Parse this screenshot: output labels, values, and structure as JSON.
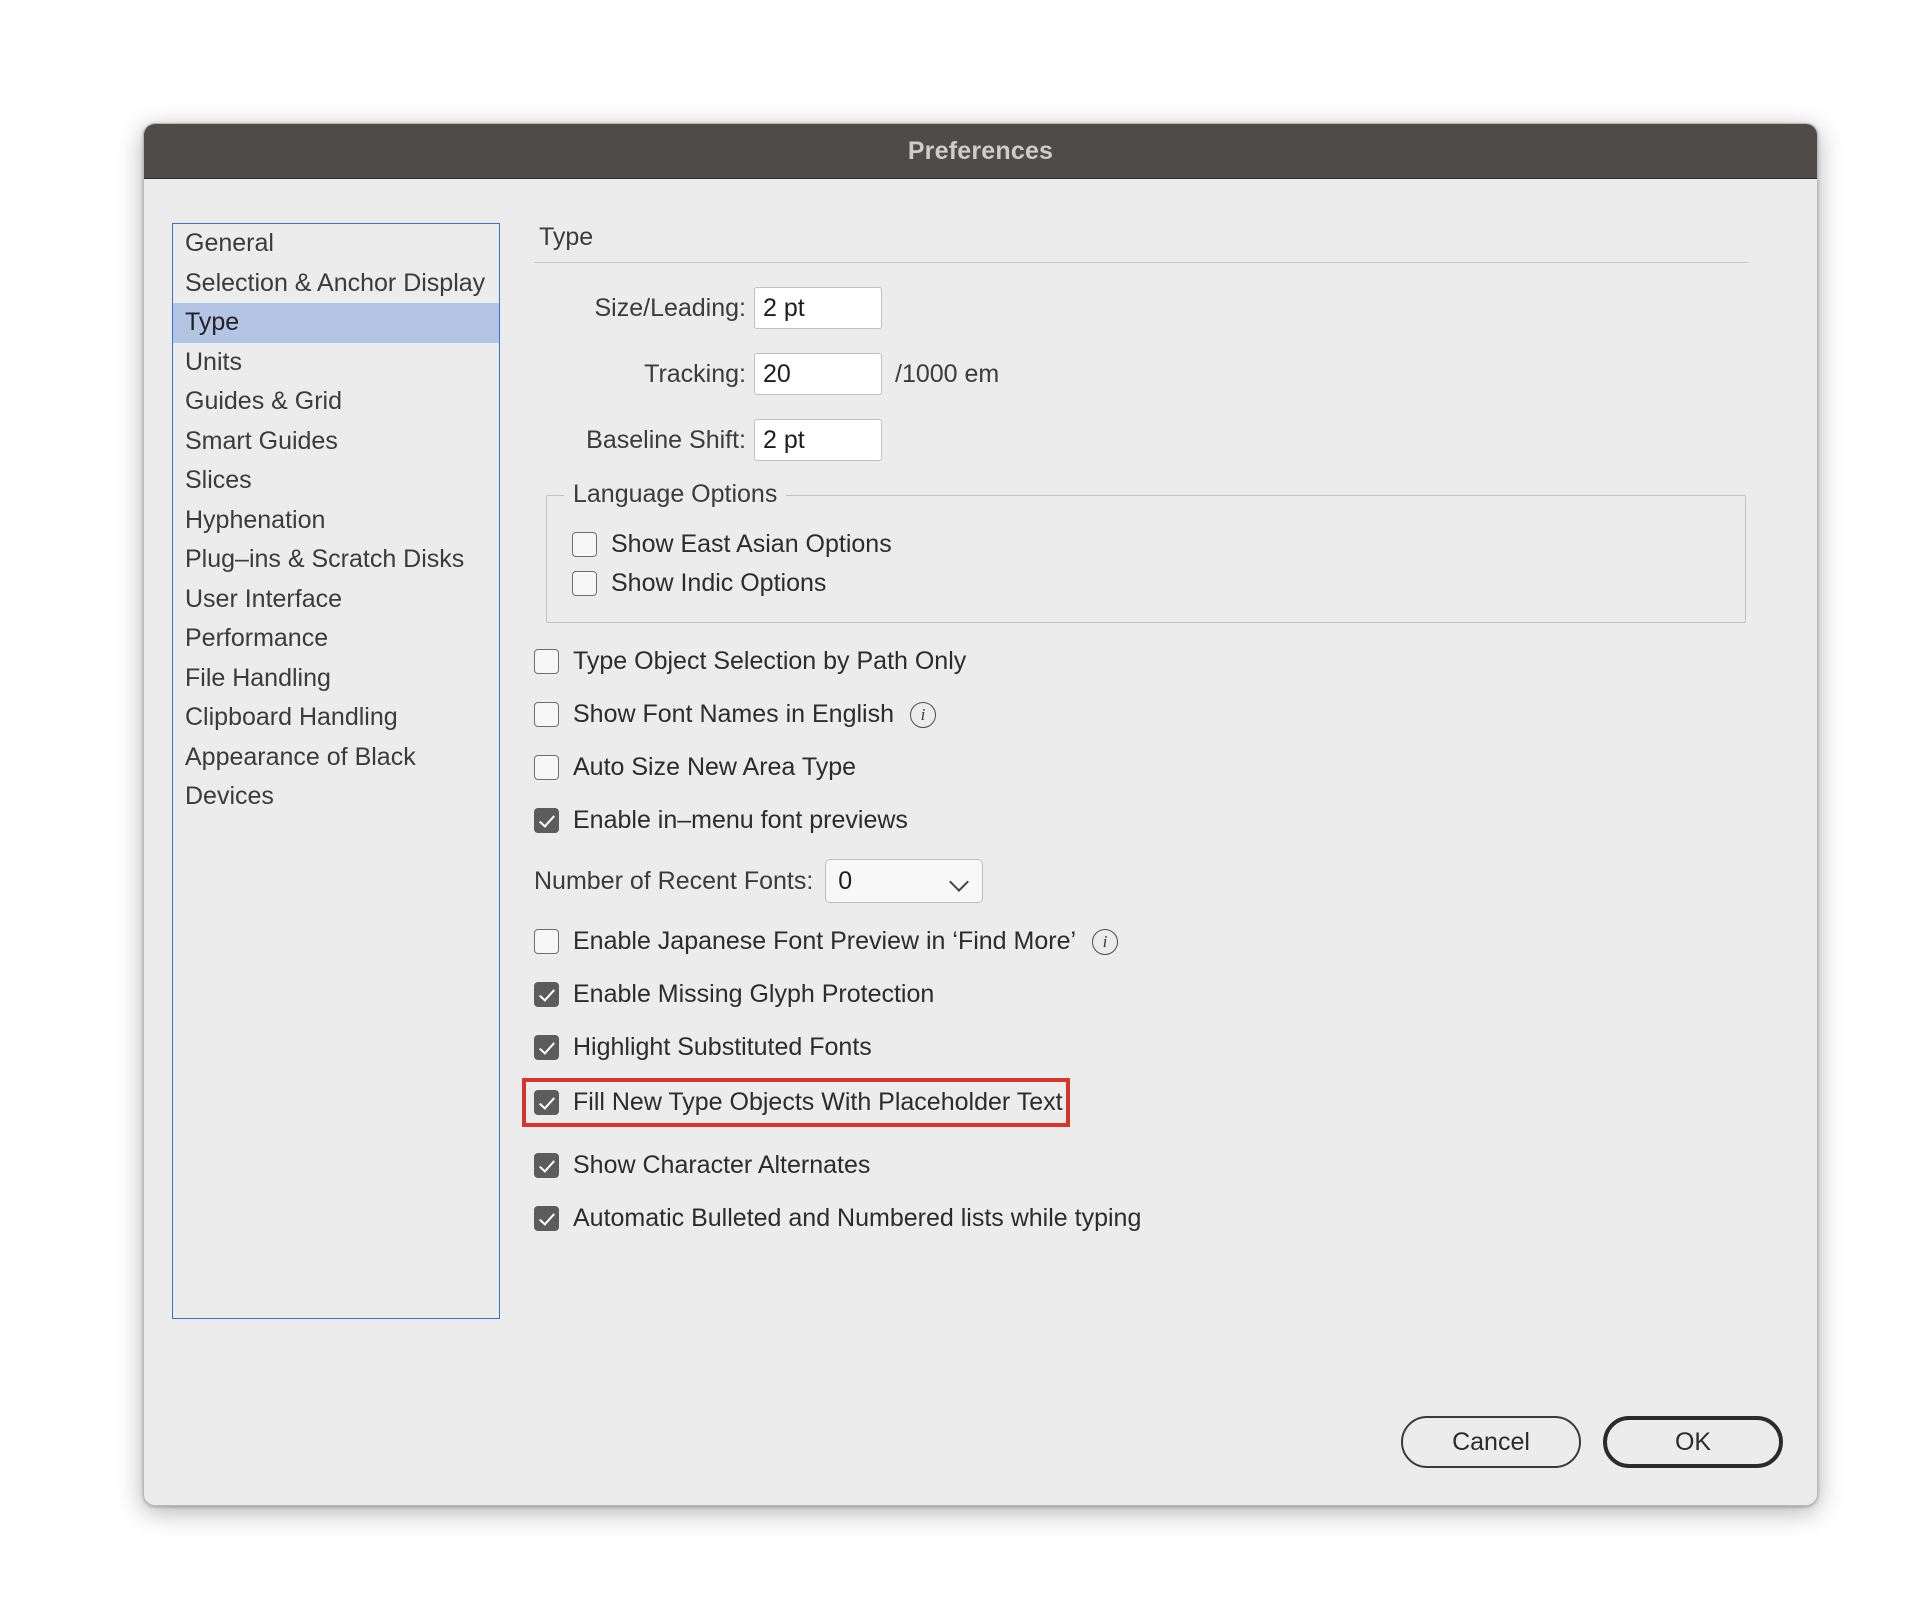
{
  "window": {
    "title": "Preferences"
  },
  "sidebar": {
    "items": [
      {
        "label": "General",
        "selected": false
      },
      {
        "label": "Selection & Anchor Display",
        "selected": false
      },
      {
        "label": "Type",
        "selected": true
      },
      {
        "label": "Units",
        "selected": false
      },
      {
        "label": "Guides & Grid",
        "selected": false
      },
      {
        "label": "Smart Guides",
        "selected": false
      },
      {
        "label": "Slices",
        "selected": false
      },
      {
        "label": "Hyphenation",
        "selected": false
      },
      {
        "label": "Plug–ins & Scratch Disks",
        "selected": false
      },
      {
        "label": "User Interface",
        "selected": false
      },
      {
        "label": "Performance",
        "selected": false
      },
      {
        "label": "File Handling",
        "selected": false
      },
      {
        "label": "Clipboard Handling",
        "selected": false
      },
      {
        "label": "Appearance of Black",
        "selected": false
      },
      {
        "label": "Devices",
        "selected": false
      }
    ]
  },
  "pane": {
    "title": "Type",
    "fields": {
      "size_leading": {
        "label": "Size/Leading:",
        "value": "2 pt",
        "suffix": ""
      },
      "tracking": {
        "label": "Tracking:",
        "value": "20",
        "suffix": "/1000 em"
      },
      "baseline_shift": {
        "label": "Baseline Shift:",
        "value": "2 pt",
        "suffix": ""
      }
    },
    "language_options": {
      "title": "Language Options",
      "checkboxes": [
        {
          "label": "Show East Asian Options",
          "checked": false
        },
        {
          "label": "Show Indic Options",
          "checked": false
        }
      ]
    },
    "options": [
      {
        "label": "Type Object Selection by Path Only",
        "checked": false,
        "info": false,
        "highlighted": false
      },
      {
        "label": "Show Font Names in English",
        "checked": false,
        "info": true,
        "highlighted": false
      },
      {
        "label": "Auto Size New Area Type",
        "checked": false,
        "info": false,
        "highlighted": false
      },
      {
        "label": "Enable in–menu font previews",
        "checked": true,
        "info": false,
        "highlighted": false
      }
    ],
    "recent_fonts": {
      "label": "Number of Recent Fonts:",
      "value": "0"
    },
    "options2": [
      {
        "label": "Enable Japanese Font Preview in ‘Find More’",
        "checked": false,
        "info": true,
        "highlighted": false
      },
      {
        "label": "Enable Missing Glyph Protection",
        "checked": true,
        "info": false,
        "highlighted": false
      },
      {
        "label": "Highlight Substituted Fonts",
        "checked": true,
        "info": false,
        "highlighted": false
      },
      {
        "label": "Fill New Type Objects With Placeholder Text",
        "checked": true,
        "info": false,
        "highlighted": true
      },
      {
        "label": "Show Character Alternates",
        "checked": true,
        "info": false,
        "highlighted": false
      },
      {
        "label": "Automatic Bulleted and Numbered lists while typing",
        "checked": true,
        "info": false,
        "highlighted": false
      }
    ]
  },
  "footer": {
    "cancel_label": "Cancel",
    "ok_label": "OK"
  },
  "colors": {
    "titlebar": "#4f4b49",
    "dialog_bg": "#ececec",
    "selection": "#b4c4e4",
    "list_border": "#3a6fd8",
    "highlight": "#d8352a"
  }
}
